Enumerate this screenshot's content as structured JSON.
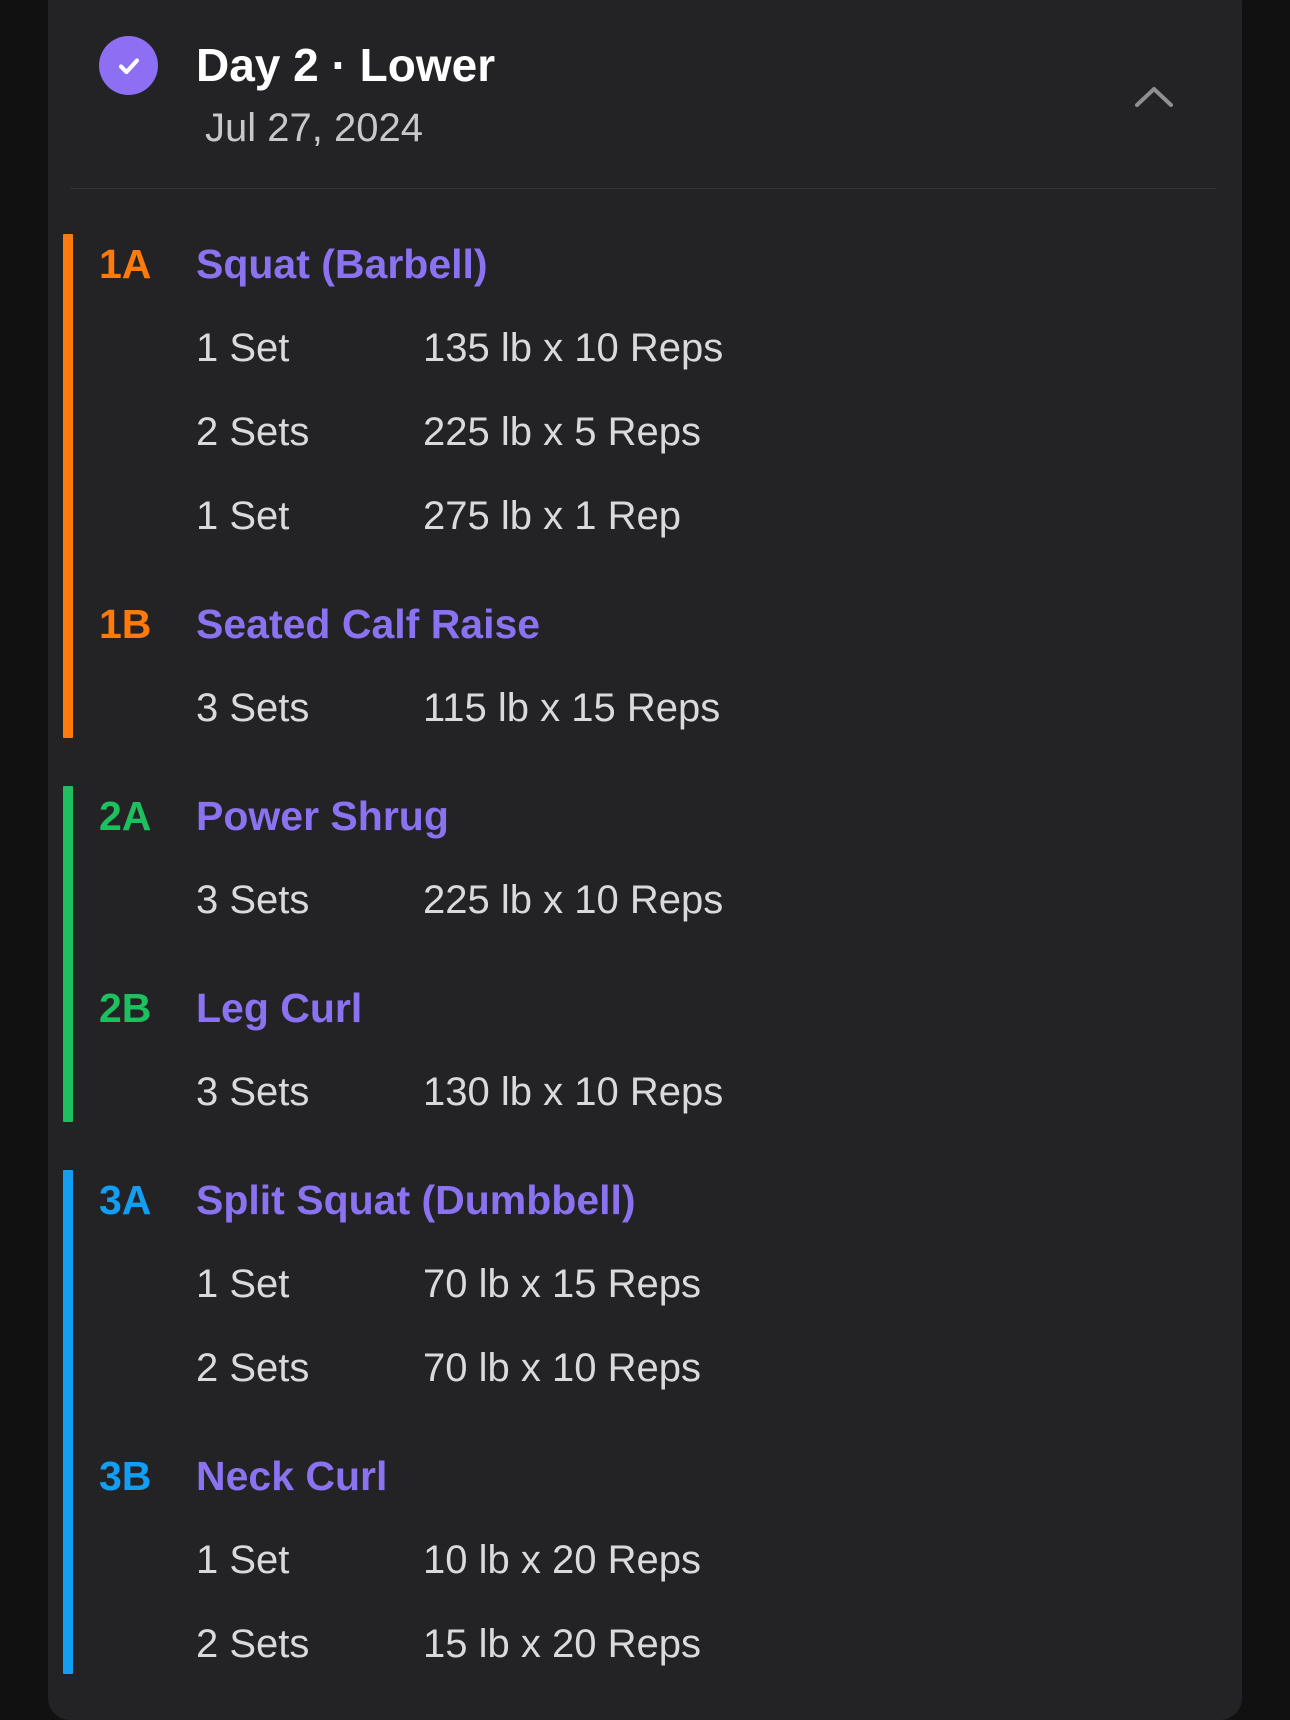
{
  "workout": {
    "title": "Day 2 · Lower",
    "date": "Jul 27, 2024",
    "completed": true,
    "status_icon": "check-icon",
    "collapse_icon": "chevron-up-icon"
  },
  "colors": {
    "accent": "#8c6ff2",
    "group_1": "#fe7a0b",
    "group_2": "#1dbf5f",
    "group_3": "#129ff3"
  },
  "groups": [
    {
      "exercises": [
        {
          "label": "1A",
          "name": "Squat (Barbell)",
          "sets": [
            {
              "count": "1 Set",
              "detail": "135 lb x 10 Reps"
            },
            {
              "count": "2 Sets",
              "detail": "225 lb x 5 Reps"
            },
            {
              "count": "1 Set",
              "detail": "275 lb x 1 Rep"
            }
          ]
        },
        {
          "label": "1B",
          "name": "Seated Calf Raise",
          "sets": [
            {
              "count": "3 Sets",
              "detail": "115 lb x 15 Reps"
            }
          ]
        }
      ]
    },
    {
      "exercises": [
        {
          "label": "2A",
          "name": "Power Shrug",
          "sets": [
            {
              "count": "3 Sets",
              "detail": "225 lb x 10 Reps"
            }
          ]
        },
        {
          "label": "2B",
          "name": "Leg Curl",
          "sets": [
            {
              "count": "3 Sets",
              "detail": "130 lb x 10 Reps"
            }
          ]
        }
      ]
    },
    {
      "exercises": [
        {
          "label": "3A",
          "name": "Split Squat (Dumbbell)",
          "sets": [
            {
              "count": "1 Set",
              "detail": "70 lb x 15 Reps"
            },
            {
              "count": "2 Sets",
              "detail": "70 lb x 10 Reps"
            }
          ]
        },
        {
          "label": "3B",
          "name": "Neck Curl",
          "sets": [
            {
              "count": "1 Set",
              "detail": "10 lb x 20 Reps"
            },
            {
              "count": "2 Sets",
              "detail": "15 lb x 20 Reps"
            }
          ]
        }
      ]
    }
  ]
}
